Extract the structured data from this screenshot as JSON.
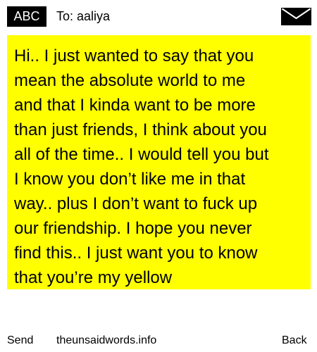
{
  "header": {
    "badge_label": "ABC",
    "to_label": "To: aaliya",
    "mail_icon": "envelope-icon"
  },
  "message": {
    "text": "Hi.. I just wanted to say that you\nmean the absolute world to me\nand that I kinda want to be more\nthan just friends, I think about you\nall of the time.. I would tell you but\nI know you don’t like me in that\nway.. plus I don’t want to fuck up\nour friendship. I hope you never\nfind this.. I just want you to know\nthat you’re my yellow",
    "background_color": "#ffff00"
  },
  "footer": {
    "send_label": "Send",
    "site_label": "theunsaidwords.info",
    "back_label": "Back"
  }
}
